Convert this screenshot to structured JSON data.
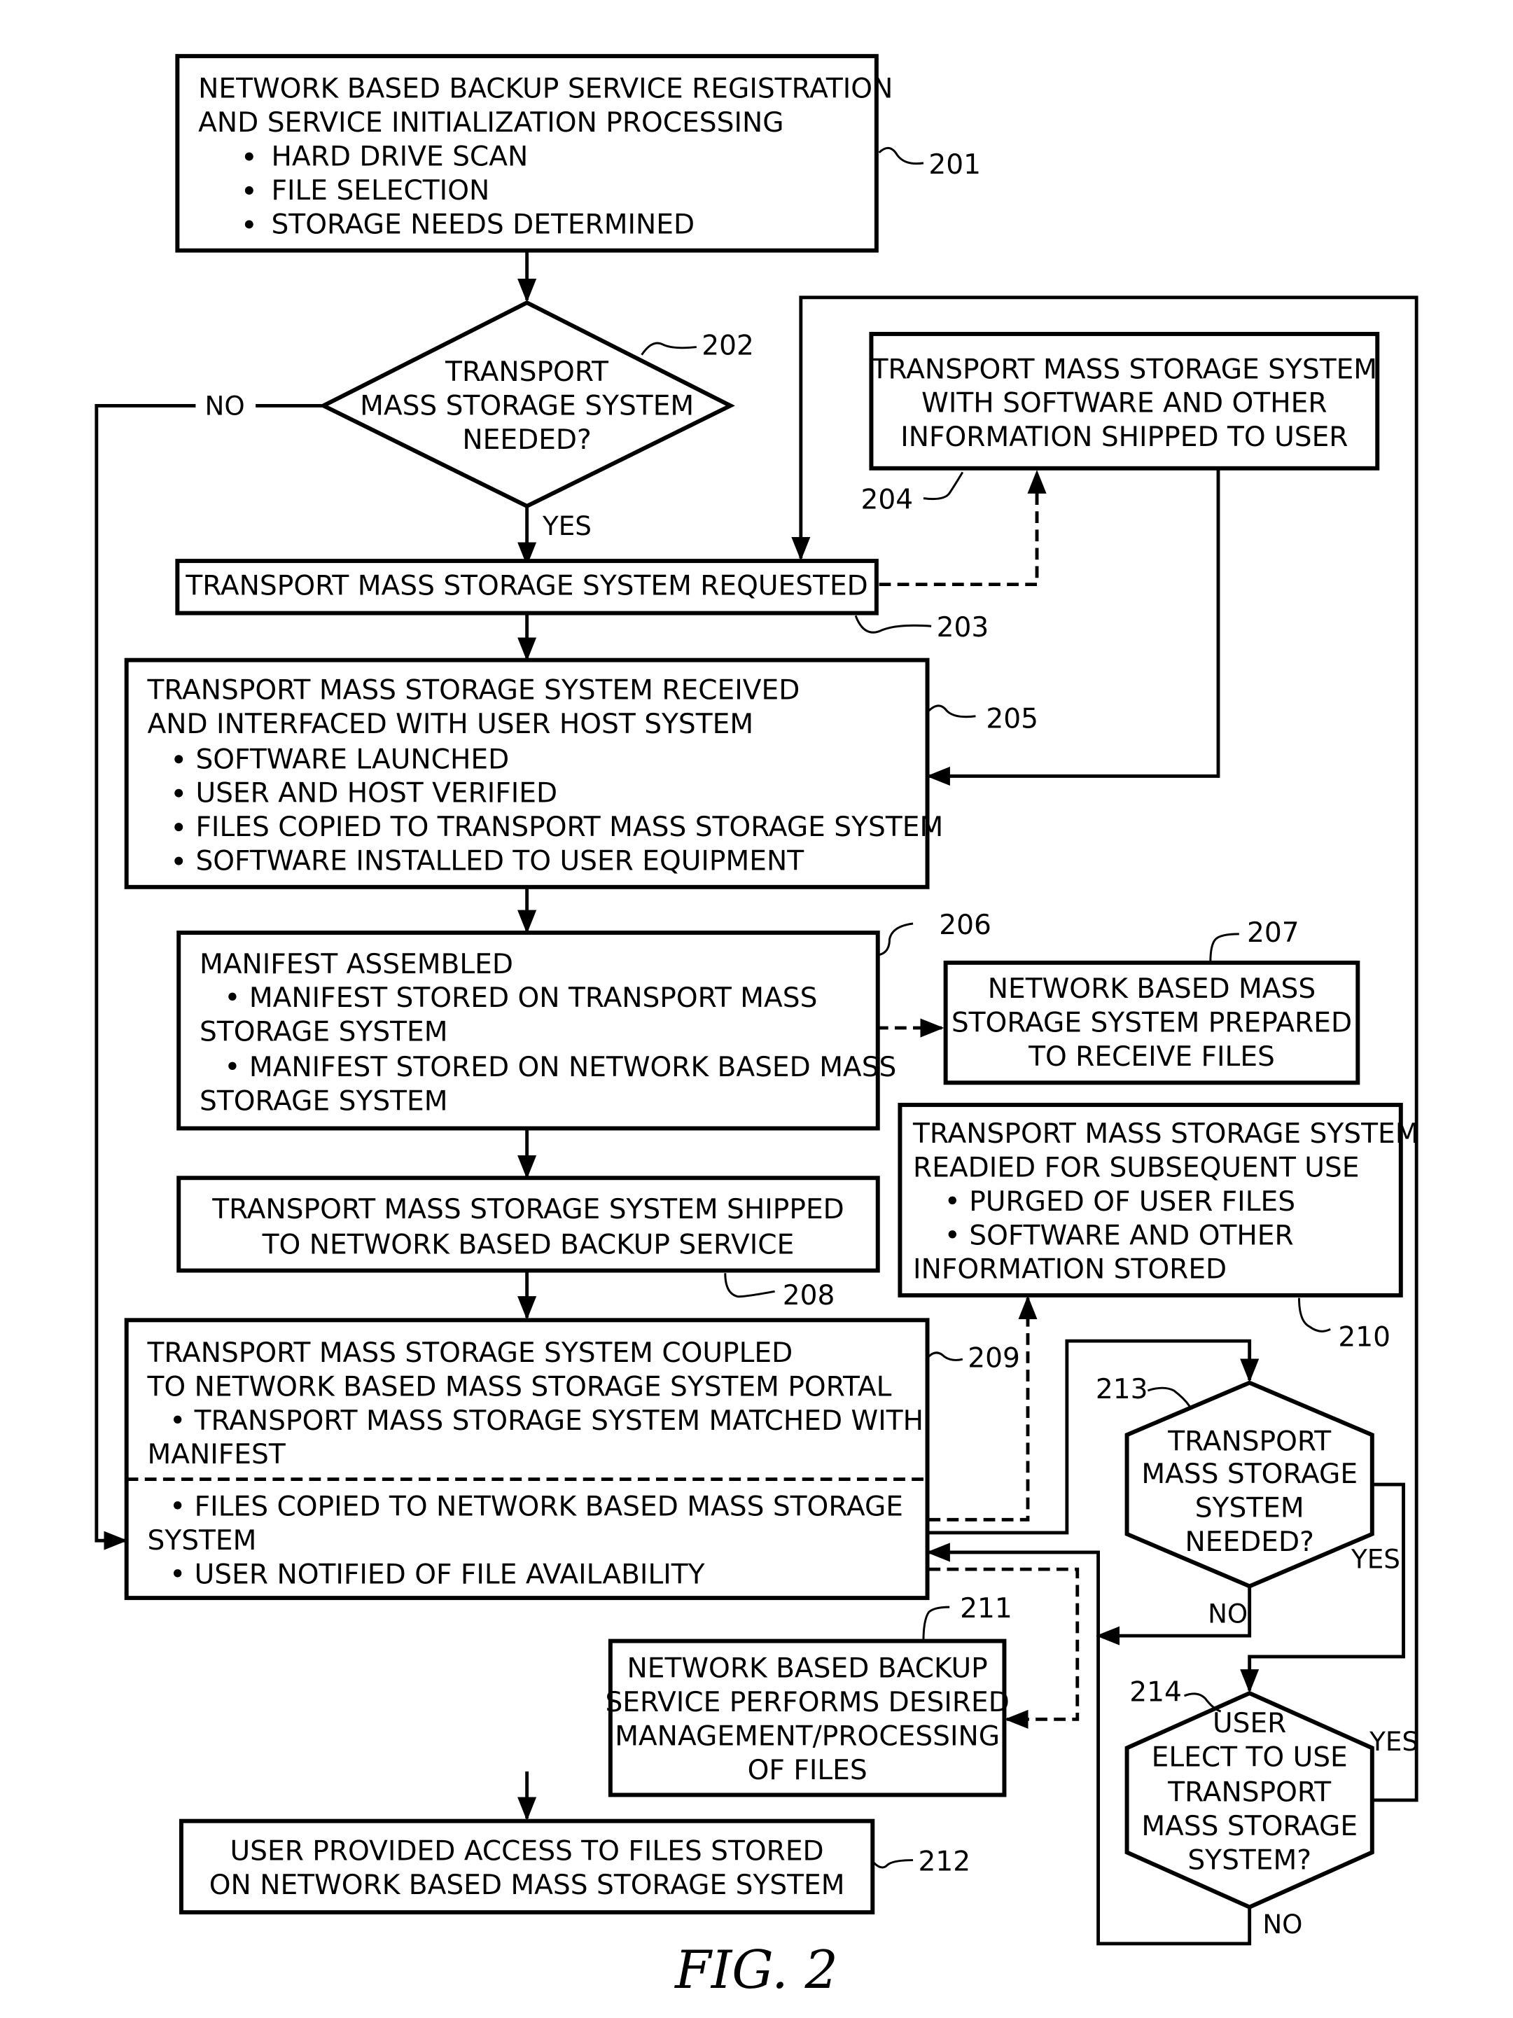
{
  "figure_label": "FIG. 2",
  "nodes": {
    "n201": {
      "ref": "201",
      "title": [
        "NETWORK BASED BACKUP SERVICE REGISTRATION",
        "AND SERVICE INITIALIZATION PROCESSING"
      ],
      "bullets": [
        "HARD DRIVE SCAN",
        "FILE SELECTION",
        "STORAGE NEEDS DETERMINED"
      ]
    },
    "n202": {
      "ref": "202",
      "lines": [
        "TRANSPORT",
        "MASS STORAGE SYSTEM",
        "NEEDED?"
      ],
      "no_label": "NO",
      "yes_label": "YES"
    },
    "n203": {
      "ref": "203",
      "text": "TRANSPORT MASS STORAGE SYSTEM REQUESTED"
    },
    "n204": {
      "ref": "204",
      "lines": [
        "TRANSPORT MASS STORAGE SYSTEM",
        "WITH SOFTWARE AND OTHER",
        "INFORMATION SHIPPED TO USER"
      ]
    },
    "n205": {
      "ref": "205",
      "title": [
        "TRANSPORT MASS STORAGE SYSTEM RECEIVED",
        "AND INTERFACED WITH USER HOST SYSTEM"
      ],
      "bullets": [
        "SOFTWARE LAUNCHED",
        "USER AND HOST VERIFIED",
        "FILES COPIED TO TRANSPORT MASS STORAGE SYSTEM",
        "SOFTWARE INSTALLED TO USER EQUIPMENT"
      ]
    },
    "n206": {
      "ref": "206",
      "lines": [
        "MANIFEST ASSEMBLED",
        "• MANIFEST STORED ON TRANSPORT MASS",
        "STORAGE SYSTEM",
        "• MANIFEST STORED ON NETWORK BASED MASS",
        "STORAGE SYSTEM"
      ]
    },
    "n207": {
      "ref": "207",
      "lines": [
        "NETWORK BASED MASS",
        "STORAGE SYSTEM PREPARED",
        "TO RECEIVE FILES"
      ]
    },
    "n208": {
      "ref": "208",
      "lines": [
        "TRANSPORT MASS STORAGE SYSTEM SHIPPED",
        "TO NETWORK BASED BACKUP SERVICE"
      ]
    },
    "n209": {
      "ref": "209",
      "upper": [
        "TRANSPORT MASS STORAGE SYSTEM COUPLED",
        "TO NETWORK BASED MASS STORAGE SYSTEM PORTAL",
        "• TRANSPORT MASS STORAGE SYSTEM MATCHED WITH",
        "MANIFEST"
      ],
      "lower": [
        "• FILES COPIED TO NETWORK BASED MASS STORAGE",
        "SYSTEM",
        "• USER NOTIFIED OF FILE AVAILABILITY"
      ]
    },
    "n210": {
      "ref": "210",
      "lines": [
        "TRANSPORT MASS STORAGE SYSTEM",
        "READIED FOR SUBSEQUENT USE",
        "• PURGED OF USER FILES",
        "• SOFTWARE AND OTHER",
        "INFORMATION STORED"
      ]
    },
    "n211": {
      "ref": "211",
      "lines": [
        "NETWORK BASED BACKUP",
        "SERVICE PERFORMS DESIRED",
        "MANAGEMENT/PROCESSING",
        "OF FILES"
      ]
    },
    "n212": {
      "ref": "212",
      "lines": [
        "USER PROVIDED ACCESS TO FILES STORED",
        "ON NETWORK BASED MASS STORAGE SYSTEM"
      ]
    },
    "n213": {
      "ref": "213",
      "lines": [
        "TRANSPORT",
        "MASS STORAGE",
        "SYSTEM",
        "NEEDED?"
      ],
      "yes_label": "YES",
      "no_label": "NO"
    },
    "n214": {
      "ref": "214",
      "lines": [
        "USER",
        "ELECT TO USE",
        "TRANSPORT",
        "MASS STORAGE",
        "SYSTEM?"
      ],
      "yes_label": "YES",
      "no_label": "NO"
    }
  }
}
